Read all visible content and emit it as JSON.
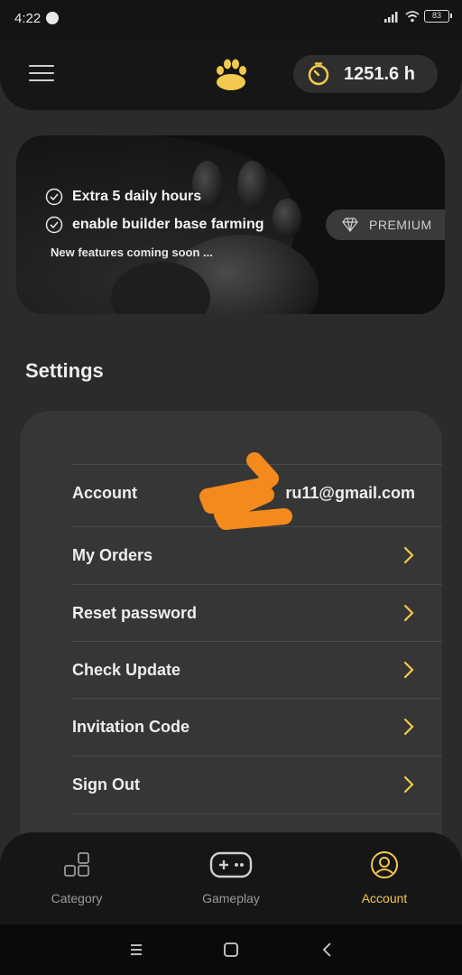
{
  "status_bar": {
    "time": "4:22",
    "battery": "83"
  },
  "header": {
    "timer_value": "1251.6 h"
  },
  "banner": {
    "features": [
      "Extra 5 daily hours",
      "enable builder base farming"
    ],
    "coming_soon": "New features coming soon ...",
    "premium_label": "PREMIUM"
  },
  "settings": {
    "title": "Settings",
    "account_label": "Account",
    "account_value": "ru11@gmail.com",
    "items": [
      {
        "label": "My Orders"
      },
      {
        "label": "Reset password"
      },
      {
        "label": "Check Update"
      },
      {
        "label": "Invitation Code"
      },
      {
        "label": "Sign Out"
      }
    ]
  },
  "bottom_nav": {
    "items": [
      {
        "label": "Category",
        "icon": "category-icon",
        "active": false
      },
      {
        "label": "Gameplay",
        "icon": "gamepad-icon",
        "active": false
      },
      {
        "label": "Account",
        "icon": "account-icon",
        "active": true
      }
    ]
  },
  "colors": {
    "accent": "#f2c94c",
    "background": "#2b2b2b",
    "card": "#363636",
    "scribble": "#f48a1c"
  }
}
